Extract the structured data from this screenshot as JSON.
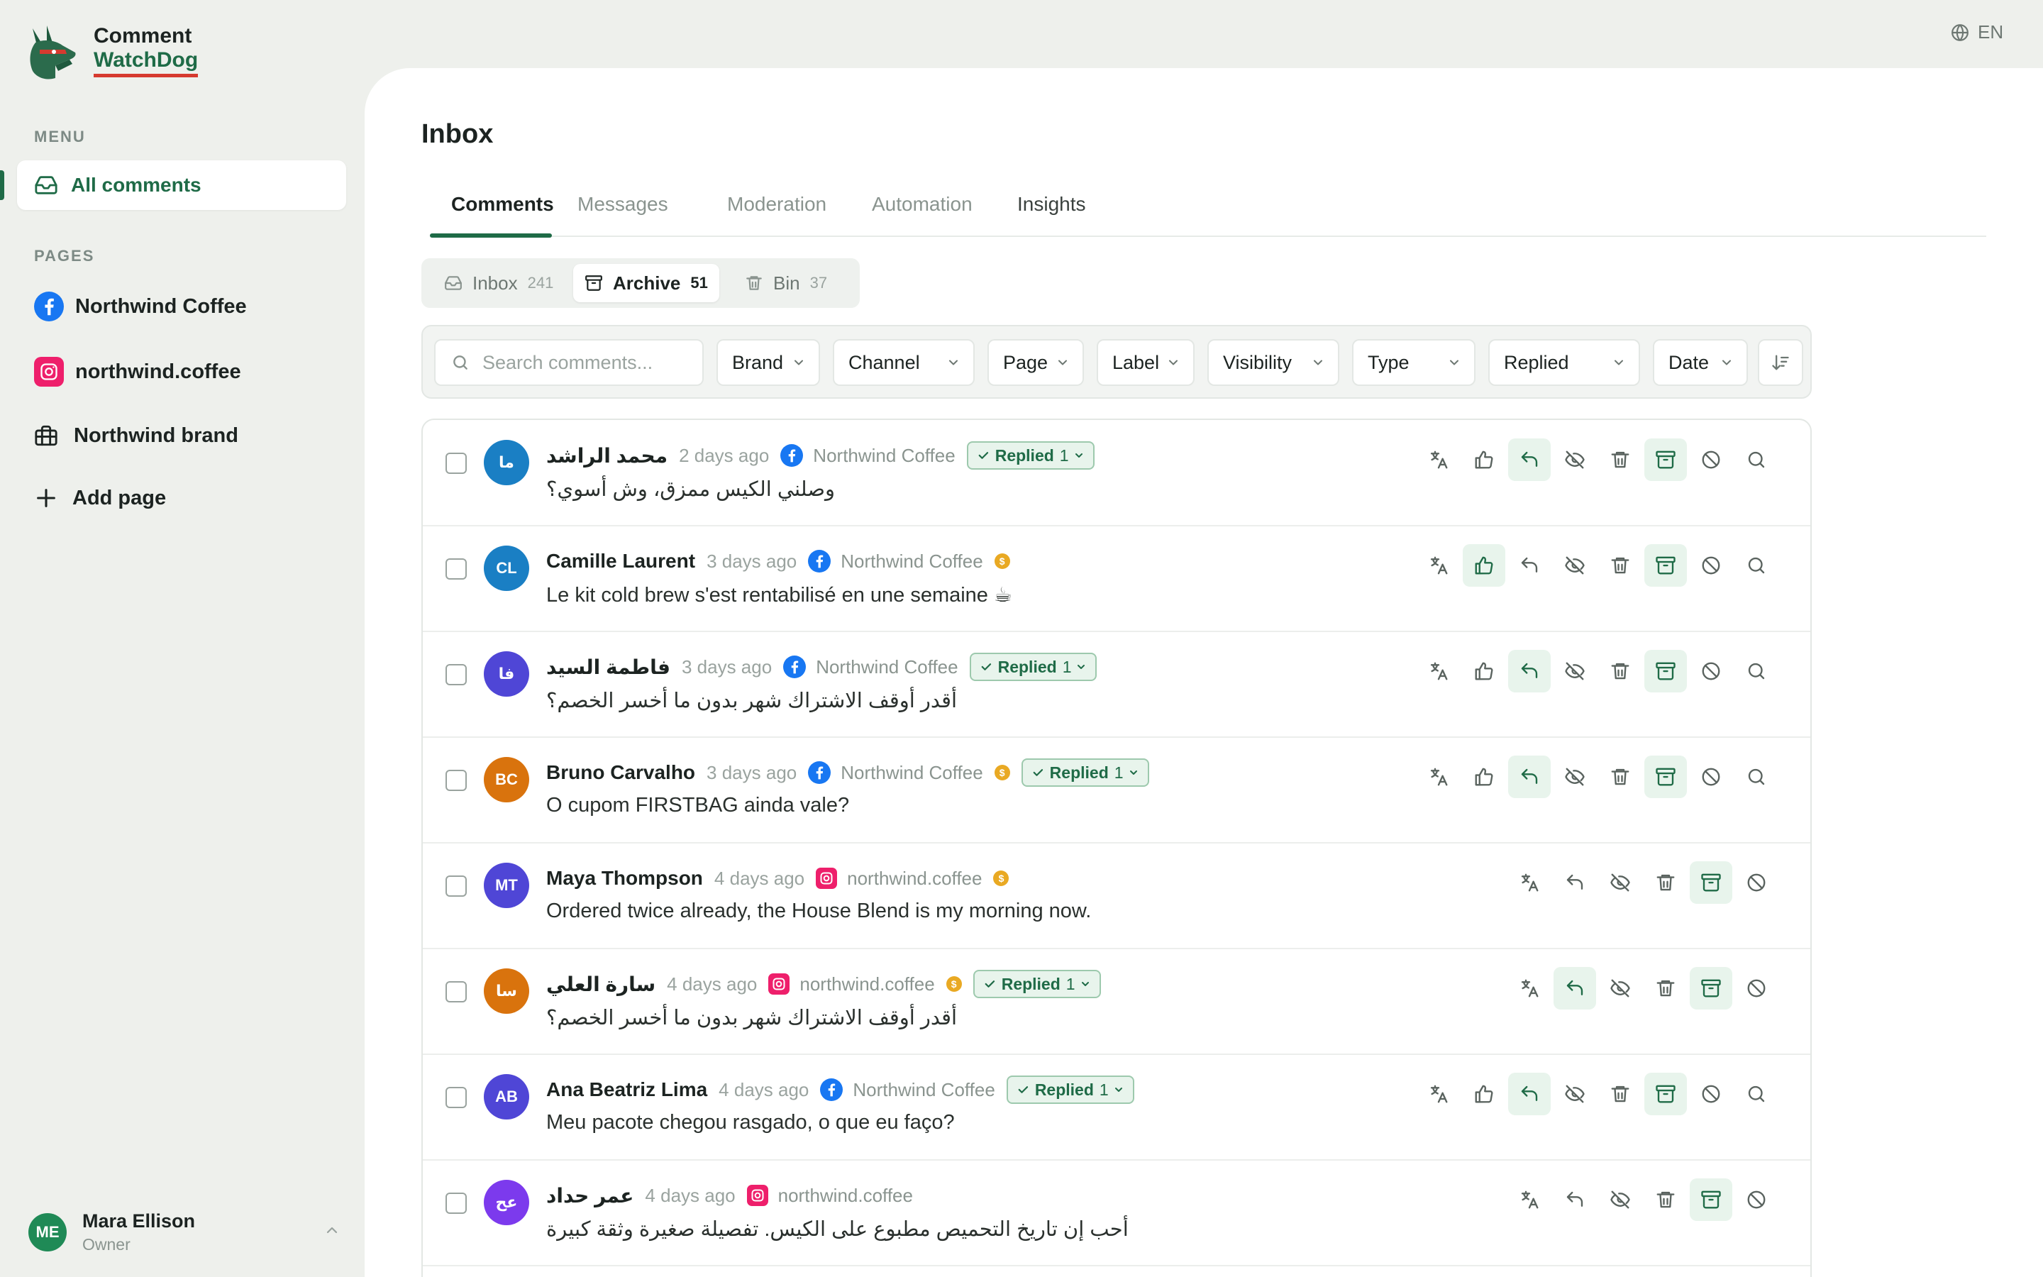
{
  "app": {
    "name_line1": "Comment",
    "name_line2": "WatchDog",
    "language": "EN"
  },
  "sidebar": {
    "menu_label": "MENU",
    "all_comments": "All comments",
    "pages_label": "PAGES",
    "pages": [
      {
        "label": "Northwind Coffee",
        "icon": "facebook-icon"
      },
      {
        "label": "northwind.coffee",
        "icon": "instagram-icon"
      },
      {
        "label": "Northwind brand",
        "icon": "briefcase-icon"
      }
    ],
    "add_page": "Add page",
    "user": {
      "initials": "ME",
      "name": "Mara Ellison",
      "role": "Owner"
    }
  },
  "main": {
    "title": "Inbox",
    "tabs": [
      "Comments",
      "Messages",
      "Moderation",
      "Automation",
      "Insights"
    ],
    "active_tab": "Comments",
    "segments": [
      {
        "label": "Inbox",
        "count": "241",
        "icon": "inbox-icon"
      },
      {
        "label": "Archive",
        "count": "51",
        "icon": "archive-icon"
      },
      {
        "label": "Bin",
        "count": "37",
        "icon": "trash-icon"
      }
    ],
    "active_segment": "Archive",
    "search_placeholder": "Search comments...",
    "filters": [
      "Brand",
      "Channel",
      "Page",
      "Label",
      "Visibility",
      "Type",
      "Replied",
      "Date"
    ]
  },
  "colors": {
    "accent": "#1f6b47",
    "replied_bg": "#e8f4ec",
    "instagram": "#ee1f6b",
    "facebook": "#1877f2",
    "coin": "#e9a923"
  },
  "comments": [
    {
      "initials": "ما",
      "avatar_color": "#1a7fc4",
      "author": "محمد الراشد",
      "time": "2 days ago",
      "channel": "facebook",
      "page": "Northwind Coffee",
      "coin": false,
      "replied": true,
      "replied_label": "Replied",
      "replied_count": "1",
      "text": "وصلني الكيس ممزق، وش أسوي؟",
      "rtl": true,
      "liked": false,
      "reply_active": true,
      "has_like": true,
      "has_search": true
    },
    {
      "initials": "CL",
      "avatar_color": "#1a7fc4",
      "author": "Camille Laurent",
      "time": "3 days ago",
      "channel": "facebook",
      "page": "Northwind Coffee",
      "coin": true,
      "replied": false,
      "text": "Le kit cold brew s'est rentabilisé en une semaine ☕",
      "rtl": false,
      "liked": true,
      "reply_active": false,
      "has_like": true,
      "has_search": true
    },
    {
      "initials": "فا",
      "avatar_color": "#4f46d6",
      "author": "فاطمة السيد",
      "time": "3 days ago",
      "channel": "facebook",
      "page": "Northwind Coffee",
      "coin": false,
      "replied": true,
      "replied_label": "Replied",
      "replied_count": "1",
      "text": "أقدر أوقف الاشتراك شهر بدون ما أخسر الخصم؟",
      "rtl": true,
      "liked": false,
      "reply_active": true,
      "has_like": true,
      "has_search": true
    },
    {
      "initials": "BC",
      "avatar_color": "#d9730d",
      "author": "Bruno Carvalho",
      "time": "3 days ago",
      "channel": "facebook",
      "page": "Northwind Coffee",
      "coin": true,
      "replied": true,
      "replied_label": "Replied",
      "replied_count": "1",
      "text": "O cupom FIRSTBAG ainda vale?",
      "rtl": false,
      "liked": false,
      "reply_active": true,
      "has_like": true,
      "has_search": true
    },
    {
      "initials": "MT",
      "avatar_color": "#4f46d6",
      "author": "Maya Thompson",
      "time": "4 days ago",
      "channel": "instagram",
      "page": "northwind.coffee",
      "coin": true,
      "replied": false,
      "text": "Ordered twice already, the House Blend is my morning now.",
      "rtl": false,
      "liked": false,
      "reply_active": false,
      "has_like": false,
      "has_search": false
    },
    {
      "initials": "سا",
      "avatar_color": "#d9730d",
      "author": "سارة العلي",
      "time": "4 days ago",
      "channel": "instagram",
      "page": "northwind.coffee",
      "coin": true,
      "replied": true,
      "replied_label": "Replied",
      "replied_count": "1",
      "text": "أقدر أوقف الاشتراك شهر بدون ما أخسر الخصم؟",
      "rtl": true,
      "liked": false,
      "reply_active": true,
      "has_like": false,
      "has_search": false
    },
    {
      "initials": "AB",
      "avatar_color": "#4f46d6",
      "author": "Ana Beatriz Lima",
      "time": "4 days ago",
      "channel": "facebook",
      "page": "Northwind Coffee",
      "coin": false,
      "replied": true,
      "replied_label": "Replied",
      "replied_count": "1",
      "text": "Meu pacote chegou rasgado, o que eu faço?",
      "rtl": false,
      "liked": false,
      "reply_active": true,
      "has_like": true,
      "has_search": true
    },
    {
      "initials": "عح",
      "avatar_color": "#7c3aed",
      "author": "عمر حداد",
      "time": "4 days ago",
      "channel": "instagram",
      "page": "northwind.coffee",
      "coin": false,
      "replied": false,
      "text": "أحب إن تاريخ التحميص مطبوع على الكيس. تفصيلة صغيرة وثقة كبيرة",
      "rtl": true,
      "liked": false,
      "reply_active": false,
      "has_like": false,
      "has_search": false
    }
  ]
}
